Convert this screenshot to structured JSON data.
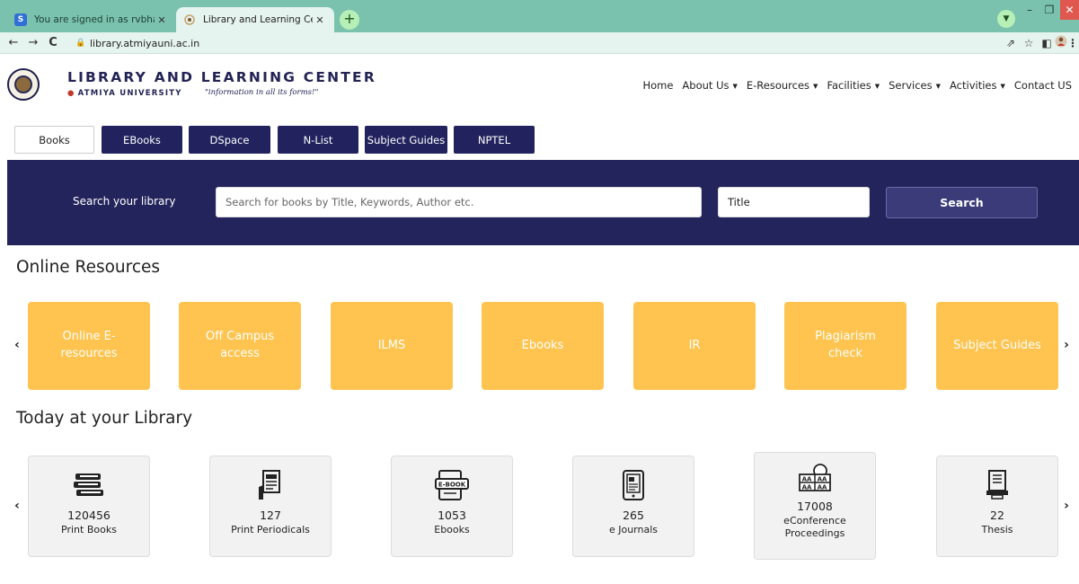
{
  "browser": {
    "tabs": [
      {
        "favicon": "S",
        "title": "You are signed in as rvbhatt"
      },
      {
        "favicon": "library-favicon",
        "title": "Library and Learning Center | Atm"
      }
    ],
    "url": "library.atmiyauni.ac.in",
    "colors": {
      "tabbar": "#7ac2ad",
      "toolbar": "#e6f4ef"
    }
  },
  "header": {
    "title": "LIBRARY AND LEARNING CENTER",
    "university": "ATMIYA UNIVERSITY",
    "tagline": "\"information in all its forms!\"",
    "nav": [
      "Home",
      "About Us",
      "E-Resources",
      "Facilities",
      "Services",
      "Activities",
      "Contact US"
    ]
  },
  "quicklinks": [
    "Books",
    "EBooks",
    "DSpace",
    "N-List",
    "Subject Guides",
    "NPTEL"
  ],
  "search": {
    "label": "Search your library",
    "placeholder": "Search for books by Title, Keywords, Author etc.",
    "field_value": "Title",
    "button": "Search"
  },
  "online_resources": {
    "title": "Online Resources",
    "items": [
      "Online E-resources",
      "Off Campus access",
      "ILMS",
      "Ebooks",
      "IR",
      "Plagiarism check",
      "Subject Guides"
    ]
  },
  "today": {
    "title": "Today at your Library",
    "stats": [
      {
        "icon": "books-icon",
        "value": "120456",
        "label": "Print Books"
      },
      {
        "icon": "periodicals-icon",
        "value": "127",
        "label": "Print Periodicals"
      },
      {
        "icon": "ebook-icon",
        "value": "1053",
        "label": "Ebooks"
      },
      {
        "icon": "ejournal-icon",
        "value": "265",
        "label": "e Journals"
      },
      {
        "icon": "conference-icon",
        "value": "17008",
        "label": "eConference Proceedings"
      },
      {
        "icon": "thesis-icon",
        "value": "22",
        "label": "Thesis"
      }
    ]
  },
  "colors": {
    "navy": "#24245c",
    "resource_card": "#fec44f",
    "stat_card": "#f2f2f2"
  }
}
